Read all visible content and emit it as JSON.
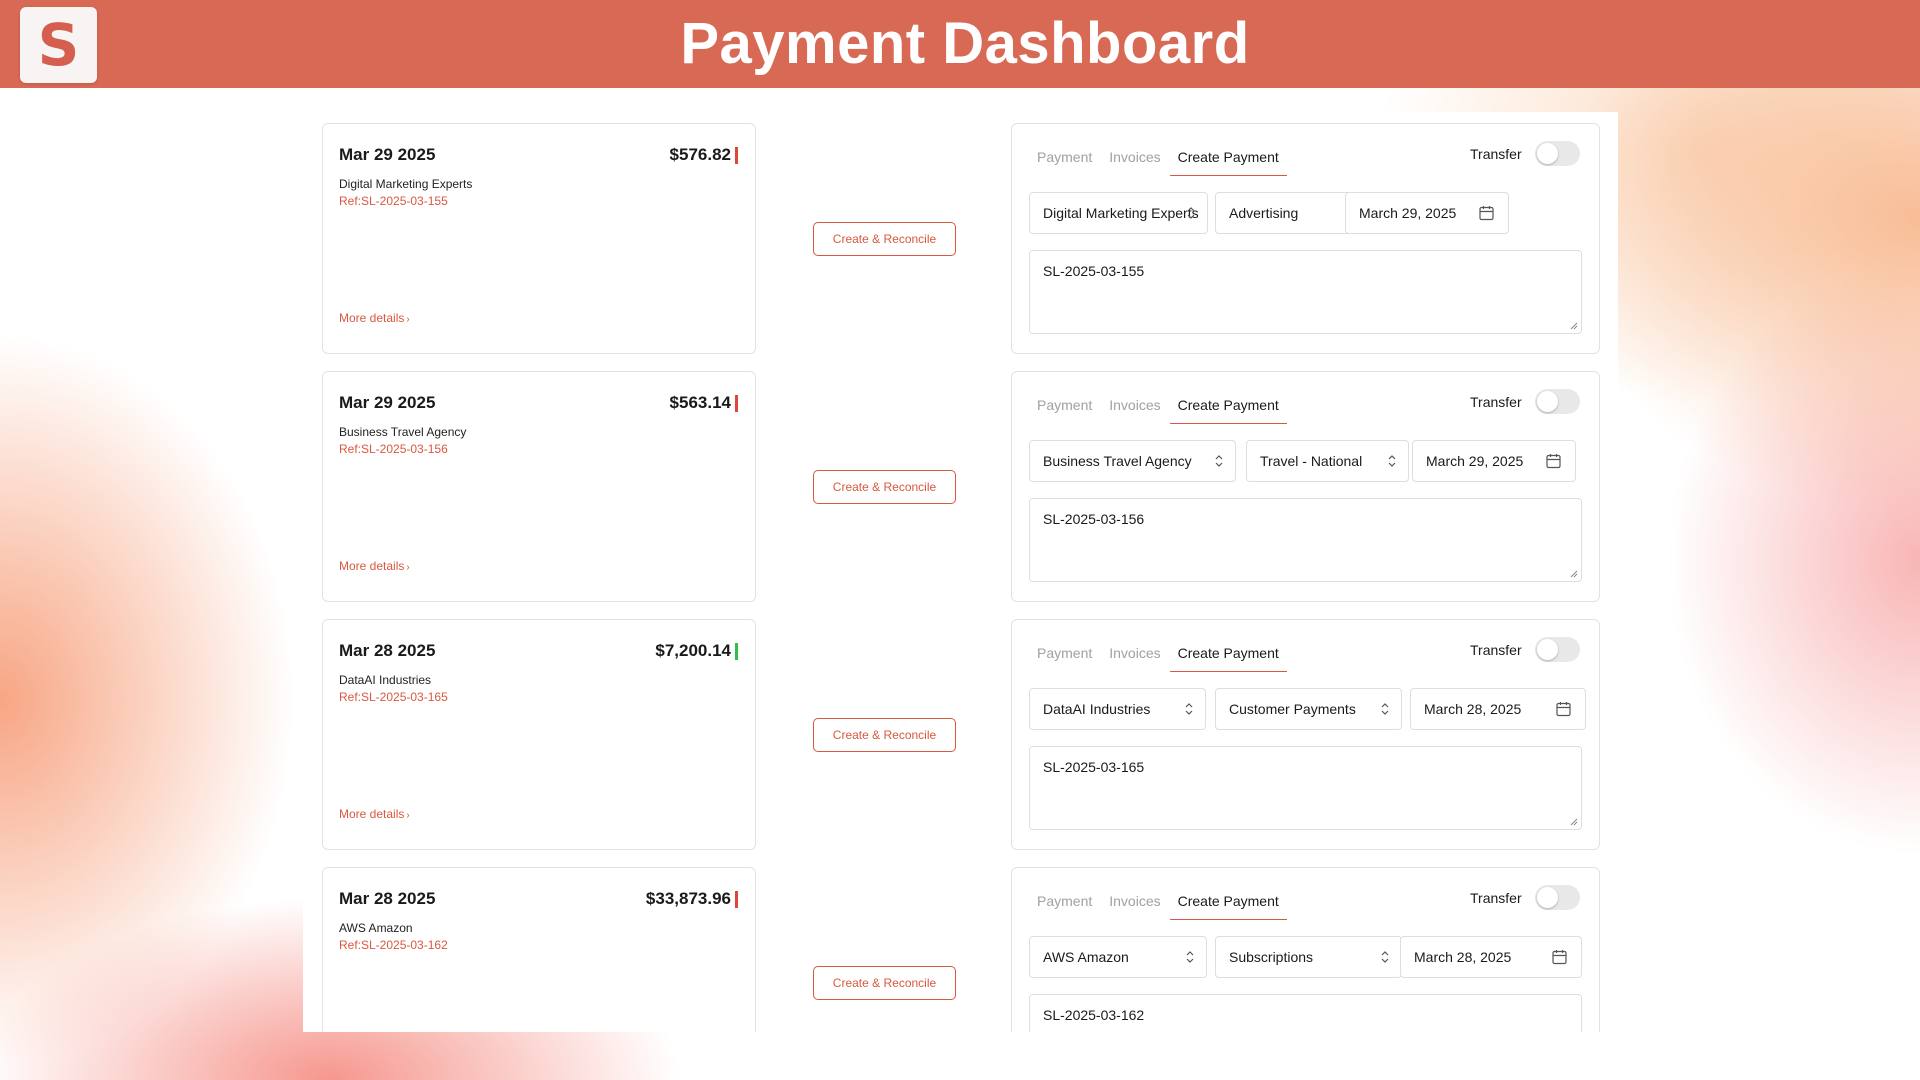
{
  "app": {
    "logo_letter": "S",
    "title": "Payment Dashboard"
  },
  "colors": {
    "brand": "#d86a55",
    "accent": "#d9583f",
    "negative": "#e0453a",
    "positive": "#2fbf4a"
  },
  "form_labels": {
    "tabs": [
      "Payment",
      "Invoices",
      "Create Payment"
    ],
    "active_tab": "Create Payment",
    "transfer": "Transfer",
    "reconcile_button": "Create & Reconcile",
    "more_details": "More details"
  },
  "transactions": [
    {
      "date": "Mar 29 2025",
      "amount": "$576.82",
      "direction": "out",
      "payee": "Digital Marketing Experts",
      "ref": "Ref:SL-2025-03-155",
      "form": {
        "contact": "Digital Marketing Experts",
        "category": "Advertising",
        "date": "March 29, 2025",
        "memo": "SL-2025-03-155",
        "transfer": false
      }
    },
    {
      "date": "Mar 29 2025",
      "amount": "$563.14",
      "direction": "out",
      "payee": "Business Travel Agency",
      "ref": "Ref:SL-2025-03-156",
      "form": {
        "contact": "Business Travel Agency",
        "category": "Travel - National",
        "date": "March 29, 2025",
        "memo": "SL-2025-03-156",
        "transfer": false
      }
    },
    {
      "date": "Mar 28 2025",
      "amount": "$7,200.14",
      "direction": "in",
      "payee": "DataAI Industries",
      "ref": "Ref:SL-2025-03-165",
      "form": {
        "contact": "DataAI Industries",
        "category": "Customer Payments",
        "date": "March 28, 2025",
        "memo": "SL-2025-03-165",
        "transfer": false
      }
    },
    {
      "date": "Mar 28 2025",
      "amount": "$33,873.96",
      "direction": "out",
      "payee": "AWS Amazon",
      "ref": "Ref:SL-2025-03-162",
      "form": {
        "contact": "AWS Amazon",
        "category": "Subscriptions",
        "date": "March 28, 2025",
        "memo": "SL-2025-03-162",
        "transfer": false
      }
    }
  ]
}
